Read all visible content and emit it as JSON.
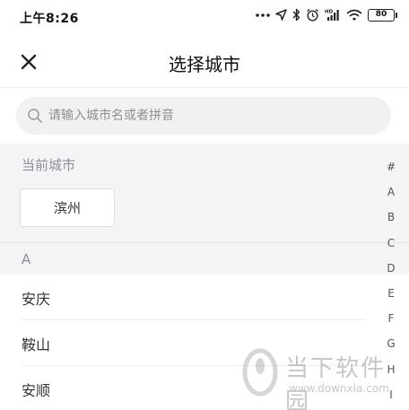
{
  "status_bar": {
    "time": "上午8:26",
    "battery": "80",
    "network_badge": "HD",
    "icons": [
      "more-dots-icon",
      "location-arrow-icon",
      "bluetooth-icon",
      "alarm-icon",
      "signal-icon",
      "wifi-icon",
      "battery-icon"
    ]
  },
  "header": {
    "title": "选择城市",
    "close_icon": "close-icon"
  },
  "search": {
    "placeholder": "请输入城市名或者拼音",
    "value": ""
  },
  "current_city": {
    "label": "当前城市",
    "city": "滨州"
  },
  "list": {
    "section_letter": "A",
    "cities": [
      "安庆",
      "鞍山",
      "安顺"
    ]
  },
  "index_bar": [
    "#",
    "A",
    "B",
    "C",
    "D",
    "E",
    "F",
    "G",
    "H",
    "I"
  ],
  "watermark": {
    "name": "当下软件园",
    "url": "www.downxia.com"
  },
  "colors": {
    "section_bg": "#f3f4f6",
    "search_bg": "#f1f1f1",
    "muted_text": "#8d8f94"
  }
}
